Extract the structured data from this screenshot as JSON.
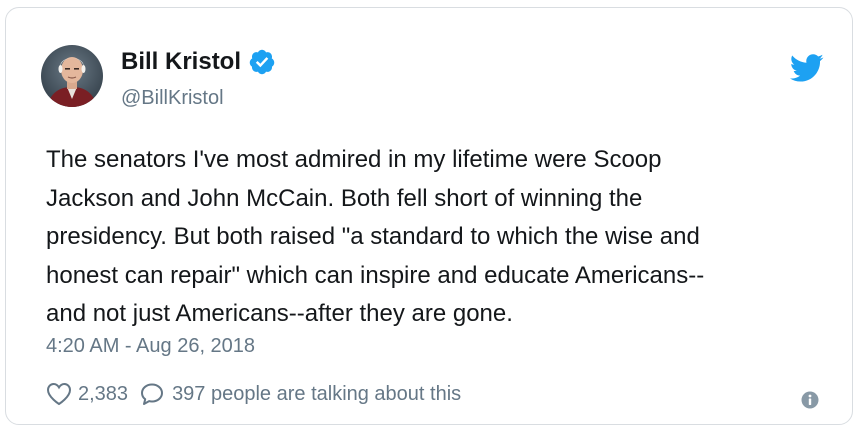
{
  "author": {
    "display_name": "Bill Kristol",
    "handle": "@BillKristol",
    "verified": true,
    "avatar_icon": "profile-photo"
  },
  "tweet": {
    "lines": [
      "The senators I've most admired in my lifetime were Scoop",
      "Jackson and John McCain. Both fell short of winning the",
      "presidency. But both raised \"a standard to which the wise and",
      "honest can repair\" which can inspire and educate Americans--",
      "and not just Americans--after they are gone."
    ],
    "timestamp": "4:20 AM - Aug 26, 2018"
  },
  "engagement": {
    "likes": "2,383",
    "replies_text": "397 people are talking about this"
  },
  "icons": {
    "brand": "twitter-bird-icon",
    "verified": "verified-badge-icon",
    "like": "heart-icon",
    "reply": "speech-bubble-icon",
    "info": "info-icon"
  },
  "colors": {
    "twitter_blue": "#1da1f2",
    "text": "#14171a",
    "secondary_text": "#657786",
    "border": "#d9dde1"
  }
}
